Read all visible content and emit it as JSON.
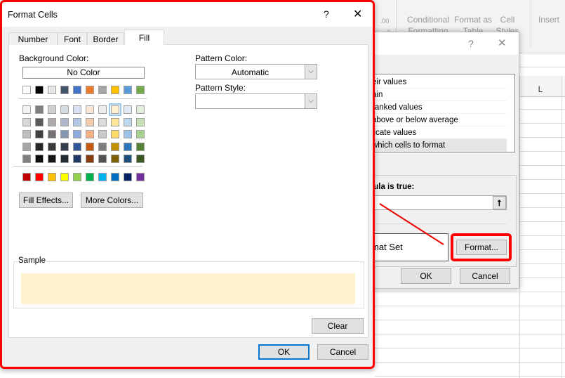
{
  "ribbon": {
    "num_format": ".00\n→.0",
    "conditional": "Conditional",
    "conditional2": "Formatting",
    "format_table": "Format as",
    "format_table2": "Table",
    "cell_styles": "Cell",
    "cell_styles2": "Styles",
    "insert": "Insert"
  },
  "sheet": {
    "column_l": "L"
  },
  "cf_dialog": {
    "help": "?",
    "close": "✕",
    "rule_types": [
      "eir values",
      "ain",
      "ranked values",
      "above or below average",
      "licate values",
      "which cells to format"
    ],
    "selected_index": 5,
    "formula_label": "mula is true:",
    "formula_value": "",
    "preview": "mat Set",
    "format_button": "Format...",
    "ok": "OK",
    "cancel": "Cancel",
    "highlight_color": "#ff0000"
  },
  "format_cells": {
    "title": "Format Cells",
    "help": "?",
    "close": "✕",
    "tabs": [
      "Number",
      "Font",
      "Border",
      "Fill"
    ],
    "active_tab": "Fill",
    "background_color_label": "Background Color:",
    "no_color": "No Color",
    "theme_colors": [
      [
        "#FFFFFF",
        "#000000",
        "#E7E6E6",
        "#44546A",
        "#4472C4",
        "#ED7D31",
        "#A5A5A5",
        "#FFC000",
        "#5B9BD5",
        "#70AD47"
      ],
      [
        "#F2F2F2",
        "#7F7F7F",
        "#D0CECE",
        "#D6DCE5",
        "#D9E2F3",
        "#FBE5D6",
        "#EDEDED",
        "#FFF2CC",
        "#DEEBF7",
        "#E2F0D9"
      ],
      [
        "#D9D9D9",
        "#595959",
        "#AFABAB",
        "#ADB9CA",
        "#B4C7E7",
        "#F8CBAD",
        "#DBDBDB",
        "#FFE699",
        "#BDD7EE",
        "#C5E0B4"
      ],
      [
        "#BFBFBF",
        "#404040",
        "#767171",
        "#8497B0",
        "#8FAADC",
        "#F4B183",
        "#C9C9C9",
        "#FFD966",
        "#9DC3E6",
        "#A9D18E"
      ],
      [
        "#A6A6A6",
        "#262626",
        "#3B3838",
        "#333F50",
        "#2F5597",
        "#C55A11",
        "#7B7B7B",
        "#BF9000",
        "#2E75B6",
        "#538135"
      ],
      [
        "#7F7F7F",
        "#0D0D0D",
        "#171616",
        "#222A35",
        "#1F3864",
        "#843C0C",
        "#525252",
        "#7F6000",
        "#1F4E79",
        "#385723"
      ]
    ],
    "standard_colors": [
      "#C00000",
      "#FF0000",
      "#FFC000",
      "#FFFF00",
      "#92D050",
      "#00B050",
      "#00B0F0",
      "#0070C0",
      "#002060",
      "#7030A0"
    ],
    "selected_color": "#FFF2CC",
    "fill_effects": "Fill Effects...",
    "more_colors": "More Colors...",
    "pattern_color_label": "Pattern Color:",
    "pattern_color_value": "Automatic",
    "pattern_style_label": "Pattern Style:",
    "pattern_style_value": "",
    "sample_label": "Sample",
    "clear": "Clear",
    "ok": "OK",
    "cancel": "Cancel"
  }
}
